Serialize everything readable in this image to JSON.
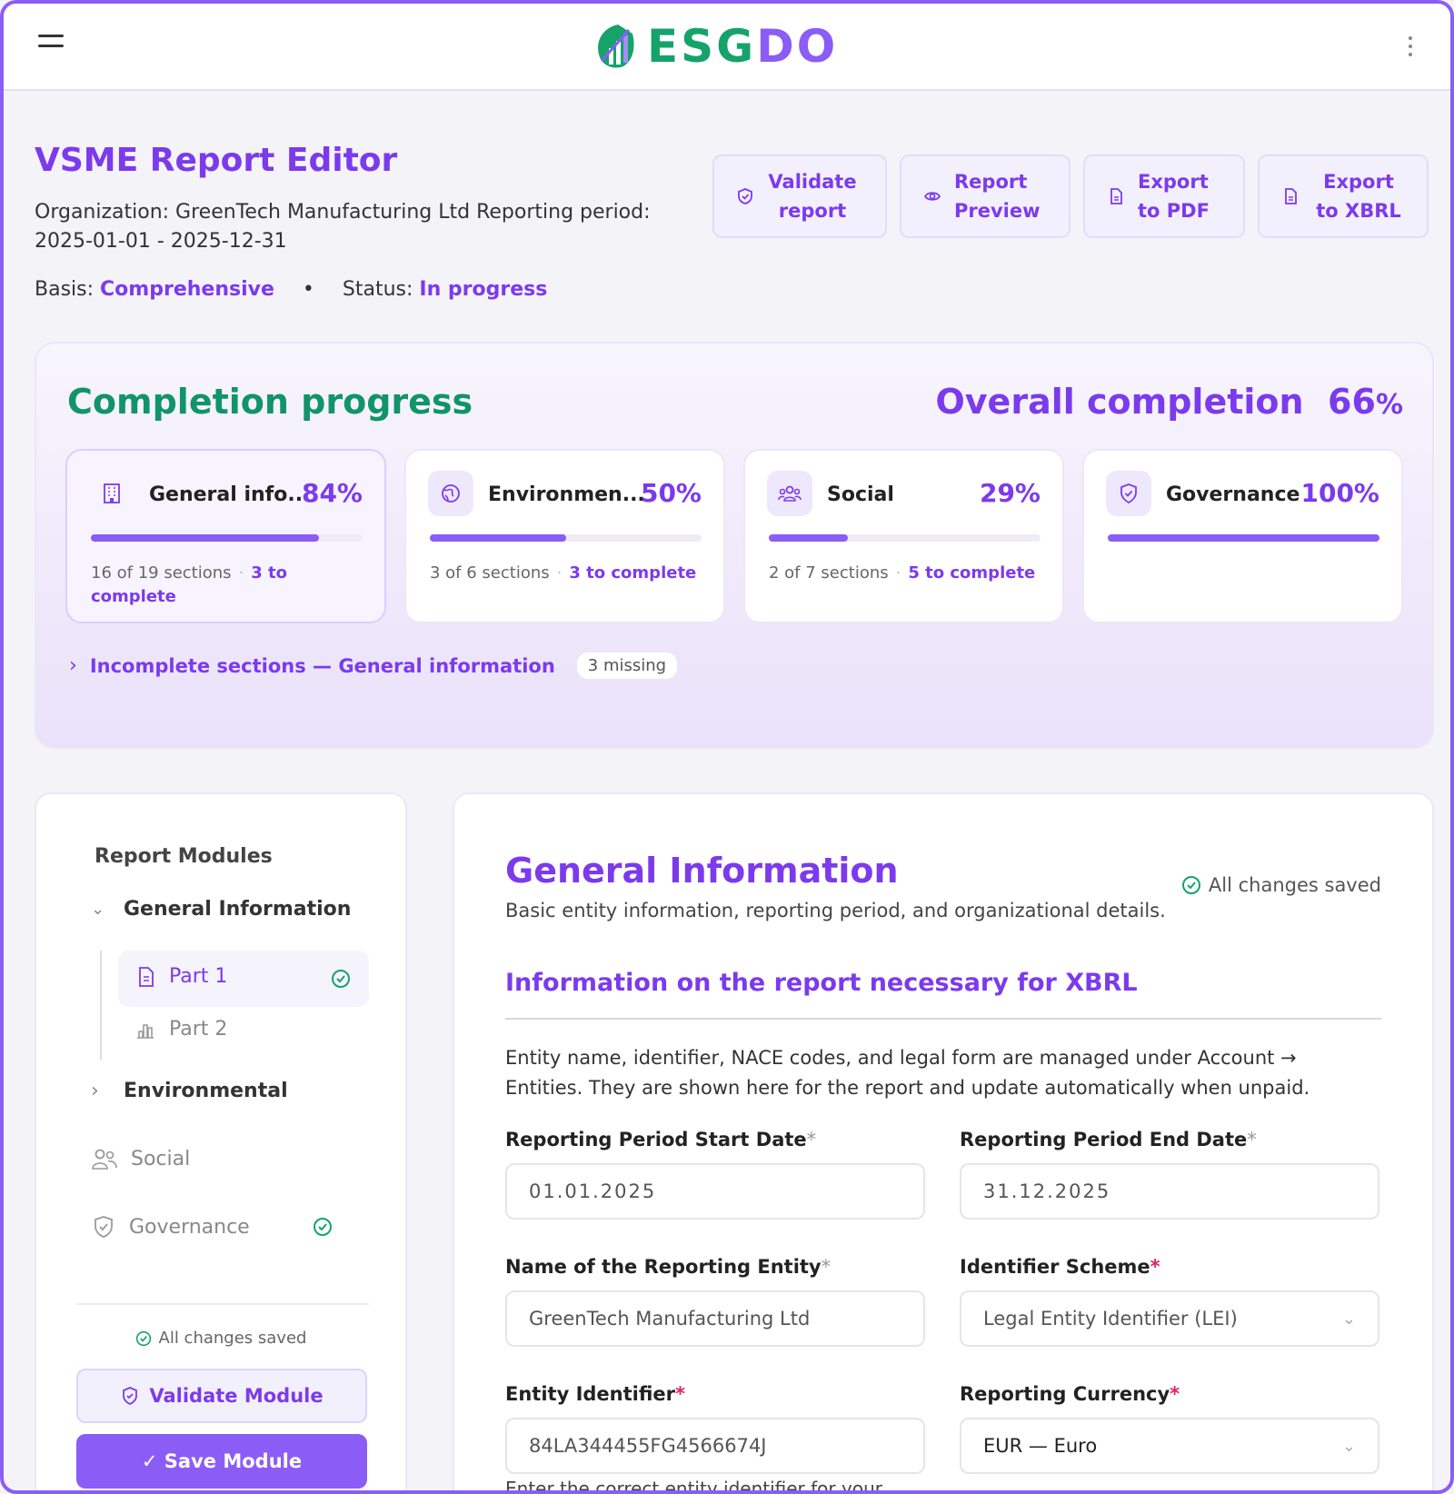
{
  "brand": {
    "name_green": "ESG",
    "name_purple": "DO"
  },
  "header": {
    "title": "VSME Report Editor",
    "org_line": "Organization: GreenTech Manufacturing Ltd Reporting period: 2025-01-01 - 2025-12-31",
    "basis_label": "Basis:",
    "basis_value": "Comprehensive",
    "status_label": "Status:",
    "status_value": "In progress",
    "separator": "•"
  },
  "actions": [
    {
      "label": "Validate report",
      "icon": "shield-check-icon"
    },
    {
      "label": "Report Preview",
      "icon": "eye-icon"
    },
    {
      "label": "Export to PDF",
      "icon": "document-icon"
    },
    {
      "label": "Export to XBRL",
      "icon": "document-icon"
    }
  ],
  "completion": {
    "title": "Completion progress",
    "overall_label": "Overall completion",
    "overall_value": "66",
    "overall_suffix": "%",
    "cards": [
      {
        "name": "General info...",
        "pct": "84%",
        "progress": 0.84,
        "sections": "16 of 19 sections",
        "todo": "3 to complete",
        "icon": "building-icon"
      },
      {
        "name": "Environmen...",
        "pct": "50%",
        "progress": 0.5,
        "sections": "3 of 6 sections",
        "todo": "3 to complete",
        "icon": "globe-icon"
      },
      {
        "name": "Social",
        "pct": "29%",
        "progress": 0.29,
        "sections": "2 of 7 sections",
        "todo": "5 to complete",
        "icon": "users-icon"
      },
      {
        "name": "Governance",
        "pct": "100%",
        "progress": 1.0,
        "sections": "",
        "todo": "",
        "icon": "shield-check-icon"
      }
    ],
    "incomplete_label": "Incomplete sections — General information",
    "incomplete_badge": "3 missing"
  },
  "sidebar": {
    "heading": "Report Modules",
    "general": "General Information",
    "part1": "Part 1",
    "part2": "Part 2",
    "environmental": "Environmental",
    "social": "Social",
    "governance": "Governance",
    "saved": "All changes saved",
    "validate_label": "Validate Module",
    "save_label": "✓ Save Module"
  },
  "form": {
    "title": "General Information",
    "subtitle": "Basic entity information, reporting period, and organizational details.",
    "saved": "All changes saved",
    "section_title": "Information on the report necessary for XBRL",
    "note": "Entity name, identifier, NACE codes, and legal form are managed under Account → Entities. They are shown here for the report and update automatically when unpaid.",
    "start_label": "Reporting Period Start Date",
    "start_value": "01.01.2025",
    "end_label": "Reporting Period End Date",
    "end_value": "31.12.2025",
    "entity_label": "Name of the Reporting Entity",
    "entity_value": "GreenTech Manufacturing Ltd",
    "scheme_label": "Identifier Scheme",
    "scheme_value": "Legal Entity Identifier (LEI)",
    "identifier_label": "Entity Identifier",
    "identifier_value": "84LA344455FG4566674J",
    "currency_label": "Reporting Currency",
    "currency_value": "EUR — Euro",
    "help": "Enter the correct entity identifier for your",
    "req": "*"
  },
  "colors": {
    "accent": "#7c3aed",
    "brand_green": "#16a36b",
    "bar": "#8b5cf6"
  }
}
